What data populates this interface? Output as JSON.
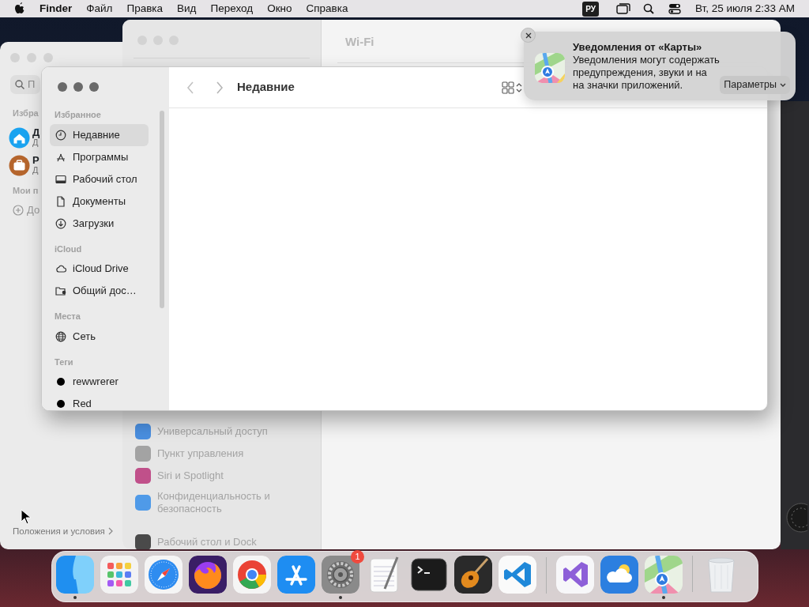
{
  "menu_bar": {
    "app_name": "Finder",
    "menus": [
      "Файл",
      "Правка",
      "Вид",
      "Переход",
      "Окно",
      "Справка"
    ],
    "input_source": "РУ",
    "clock": "Вт, 25 июля 2:33 AM"
  },
  "back_window": {
    "search_placeholder": "П",
    "section": "Избра",
    "accounts": [
      {
        "title": "Д",
        "subtitle": "Д",
        "color": "#1aa3f0",
        "kind": "home"
      },
      {
        "title": "Р",
        "subtitle": "Д",
        "color": "#b5652c",
        "kind": "briefcase"
      }
    ],
    "section_2": "Мои п",
    "add_label": "До",
    "footer_link": "Положения и условия"
  },
  "settings_window": {
    "pane_title": "Wi-Fi",
    "groups": [
      [
        {
          "label": "Универсальный доступ",
          "color": "#4a8fe0"
        },
        {
          "label": "Пункт управления",
          "color": "#a3a3a3"
        },
        {
          "label": "Siri и Spotlight",
          "color": "#c0508a"
        },
        {
          "label": "Конфиденциальность и безопасность",
          "color": "#4f9ae8"
        }
      ],
      [
        {
          "label": "Рабочий стол и Dock",
          "color": "#4a4a4a"
        }
      ]
    ]
  },
  "finder": {
    "title": "Недавние",
    "sections": [
      {
        "heading": "Избранное",
        "items": [
          {
            "label": "Недавние",
            "kind": "clock",
            "selected": true
          },
          {
            "label": "Программы",
            "kind": "apps",
            "selected": false
          },
          {
            "label": "Рабочий стол",
            "kind": "desktop",
            "selected": false
          },
          {
            "label": "Документы",
            "kind": "document",
            "selected": false
          },
          {
            "label": "Загрузки",
            "kind": "download",
            "selected": false
          }
        ]
      },
      {
        "heading": "iCloud",
        "items": [
          {
            "label": "iCloud Drive",
            "kind": "cloud",
            "selected": false
          },
          {
            "label": "Общий дос…",
            "kind": "shared",
            "selected": false
          }
        ]
      },
      {
        "heading": "Места",
        "items": [
          {
            "label": "Сеть",
            "kind": "globe",
            "selected": false
          }
        ]
      },
      {
        "heading": "Теги",
        "items": [
          {
            "label": "rewwrerer",
            "kind": "tag",
            "color": "#000000",
            "selected": false
          },
          {
            "label": "Red",
            "kind": "tag",
            "color": "#000000",
            "selected": false
          }
        ]
      }
    ]
  },
  "notification": {
    "title": "Уведомления от «Карты»",
    "body": [
      "Уведомления могут содержать",
      "предупреждения, звуки и на",
      "на значки приложений."
    ],
    "button": "Параметры"
  },
  "dock": {
    "apps": [
      {
        "kind": "finder",
        "running": true
      },
      {
        "kind": "launchpad",
        "running": false
      },
      {
        "kind": "safari",
        "running": false
      },
      {
        "kind": "firefox",
        "running": false
      },
      {
        "kind": "chrome",
        "running": false
      },
      {
        "kind": "appstore",
        "running": false
      },
      {
        "kind": "settings",
        "running": true,
        "badge": "1"
      },
      {
        "kind": "textedit",
        "running": false
      },
      {
        "kind": "terminal",
        "running": false
      },
      {
        "kind": "garageband",
        "running": false
      },
      {
        "kind": "vscode",
        "running": false
      }
    ],
    "recent_apps": [
      {
        "kind": "visualstudio",
        "running": false
      },
      {
        "kind": "weather",
        "running": false
      },
      {
        "kind": "maps",
        "running": true
      }
    ]
  }
}
